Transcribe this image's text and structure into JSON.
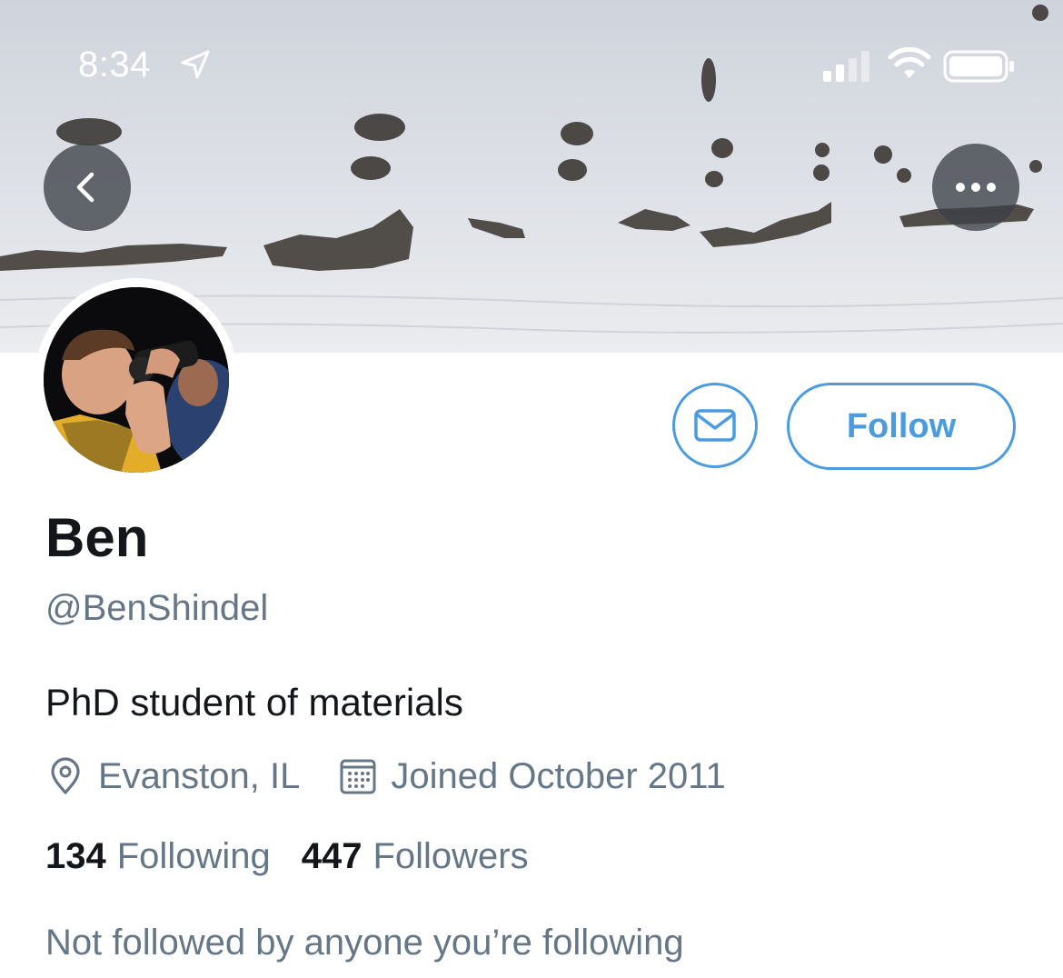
{
  "status_bar": {
    "time": "8:34",
    "icons": [
      "location-arrow-icon",
      "signal-icon",
      "wifi-icon",
      "battery-icon"
    ]
  },
  "header": {
    "back_icon": "chevron-left-icon",
    "more_icon": "ellipsis-icon"
  },
  "actions": {
    "message_icon": "envelope-icon",
    "follow_label": "Follow"
  },
  "profile": {
    "display_name": "Ben",
    "handle": "@BenShindel",
    "bio": "PhD student of materials",
    "location": "Evanston, IL",
    "joined": "Joined October 2011",
    "following_count": "134",
    "following_label": "Following",
    "followers_count": "447",
    "followers_label": "Followers",
    "followed_by": "Not followed by anyone you’re following"
  },
  "colors": {
    "accent": "#4a9be0",
    "text_primary": "#14171a",
    "text_secondary": "#657786"
  }
}
